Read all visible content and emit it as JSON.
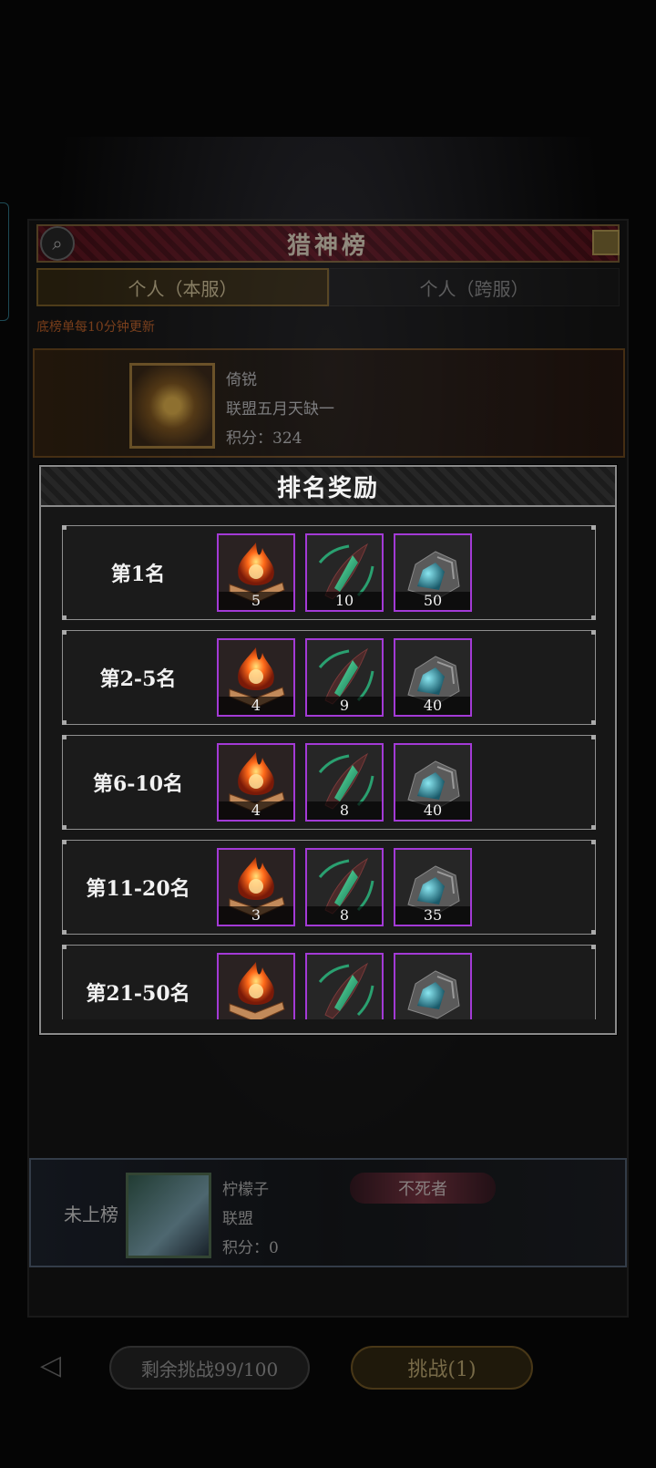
{
  "board": {
    "title": "猎神榜",
    "tabs": [
      "个人（本服）",
      "个人（跨服）"
    ],
    "refresh_note": "底榜单每10分钟更新",
    "top_entry": {
      "name": "倚锐",
      "guild": "联盟五月天缺一",
      "score": "积分：324"
    },
    "my_entry": {
      "rank": "未上榜",
      "name": "柠檬子",
      "guild": "联盟",
      "score": "积分：0",
      "honor": "不死者"
    }
  },
  "bottom": {
    "back": "◁",
    "challenge": "剩余挑战99/100",
    "fight": "挑战(1)"
  },
  "modal": {
    "title": "排名奖励",
    "rows": [
      {
        "rank": "第1名",
        "items": [
          {
            "icon": "fire-book-icon",
            "qty": "5"
          },
          {
            "icon": "green-blade-icon",
            "qty": "10"
          },
          {
            "icon": "blue-ore-icon",
            "qty": "50"
          }
        ]
      },
      {
        "rank": "第2-5名",
        "items": [
          {
            "icon": "fire-book-icon",
            "qty": "4"
          },
          {
            "icon": "green-blade-icon",
            "qty": "9"
          },
          {
            "icon": "blue-ore-icon",
            "qty": "40"
          }
        ]
      },
      {
        "rank": "第6-10名",
        "items": [
          {
            "icon": "fire-book-icon",
            "qty": "4"
          },
          {
            "icon": "green-blade-icon",
            "qty": "8"
          },
          {
            "icon": "blue-ore-icon",
            "qty": "40"
          }
        ]
      },
      {
        "rank": "第11-20名",
        "items": [
          {
            "icon": "fire-book-icon",
            "qty": "3"
          },
          {
            "icon": "green-blade-icon",
            "qty": "8"
          },
          {
            "icon": "blue-ore-icon",
            "qty": "35"
          }
        ]
      },
      {
        "rank": "第21-50名",
        "items": [
          {
            "icon": "fire-book-icon",
            "qty": ""
          },
          {
            "icon": "green-blade-icon",
            "qty": ""
          },
          {
            "icon": "blue-ore-icon",
            "qty": ""
          }
        ]
      }
    ]
  },
  "colors": {
    "item_border": "#a33ad6",
    "modal_border": "#8a8a8a",
    "board_header": "#6a1420"
  }
}
